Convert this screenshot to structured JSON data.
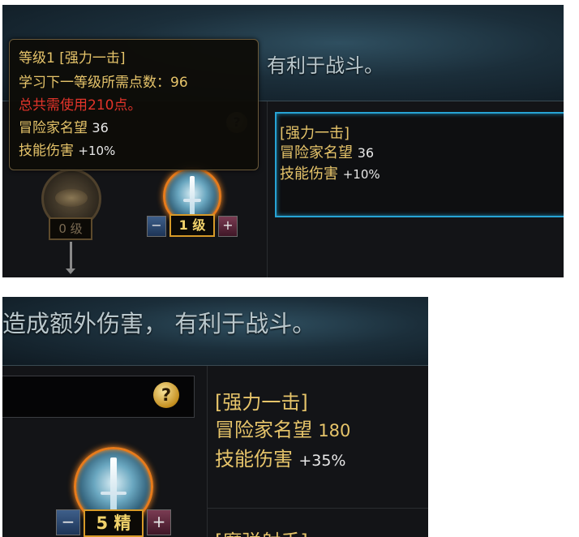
{
  "top": {
    "banner_text": "有利于战斗。",
    "tooltip": {
      "line1": "等级1 [强力一击]",
      "line2": "学习下一等级所需点数：96",
      "line3": "总共需使用210点。",
      "line4_label": "冒险家名望",
      "line4_value": "36",
      "line5_label": "技能伤害",
      "line5_value": "+10%"
    },
    "help_glyph": "?",
    "info": {
      "title": "[强力一击]",
      "fame_label": "冒险家名望",
      "fame_value": "36",
      "damage_label": "技能伤害",
      "damage_value": "+10%"
    },
    "left_skill_level": "0 级",
    "skill_level": "1 级",
    "minus": "−",
    "plus": "+"
  },
  "bottom": {
    "banner_text": "造成额外伤害， 有利于战斗。",
    "help_glyph": "?",
    "info": {
      "title": "[强力一击]",
      "fame_label": "冒险家名望",
      "fame_value": "180",
      "damage_label": "技能伤害",
      "damage_value": "+35%",
      "next_partial": "[魔弹射手]"
    },
    "skill_level": "5 精",
    "minus": "−",
    "plus": "+"
  },
  "colors": {
    "gold_text": "#e6c46a",
    "red_text": "#e2342a",
    "accent_blue": "#27a3d4",
    "level_border": "#d79a28"
  }
}
